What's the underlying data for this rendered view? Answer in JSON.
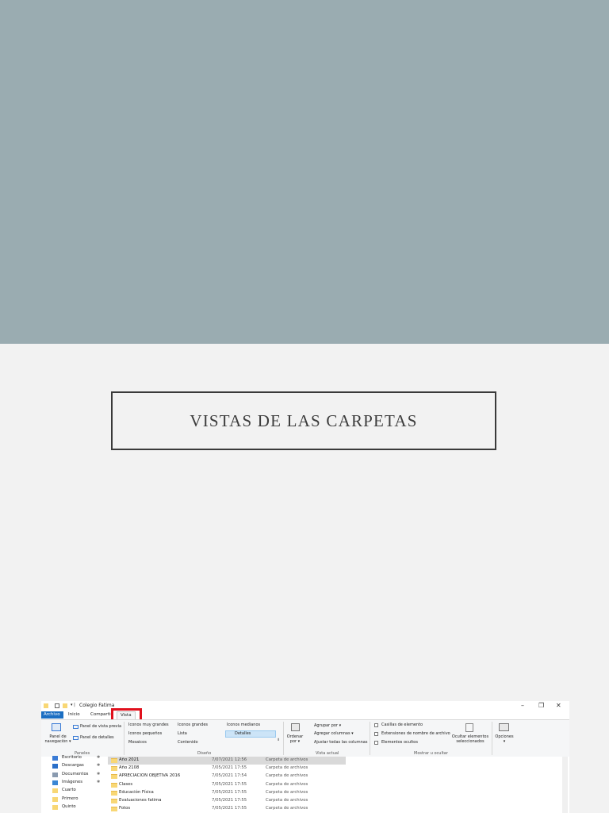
{
  "slide": {
    "title": "VISTAS DE LAS CARPETAS"
  },
  "window": {
    "title": "Colegio Fatima",
    "qa_separator": "▾ |"
  },
  "tabs": [
    "Archivo",
    "Inicio",
    "Compartir",
    "Vista"
  ],
  "ribbon": {
    "panel_navegacion": "Panel de navegación ▾",
    "panel_vista_previa": "Panel de vista previa",
    "panel_detalles": "Panel de detalles",
    "group_paneles": "Paneles",
    "layout": {
      "iconos_muy_grandes": "Iconos muy grandes",
      "iconos_grandes": "Iconos grandes",
      "iconos_medianos": "Iconos medianos",
      "iconos_pequenos": "Iconos pequeños",
      "lista": "Lista",
      "detalles": "Detalles",
      "mosaicos": "Mosaicos",
      "contenido": "Contenido"
    },
    "group_diseno": "Diseño",
    "ordenar_por": "Ordenar por ▾",
    "agrupar_por": "Agrupar por ▾",
    "agregar_columnas": "Agregar columnas ▾",
    "ajustar_columnas": "Ajustar todas las columnas",
    "group_vista_actual": "Vista actual",
    "casillas": "Casillas de elemento",
    "extensiones": "Extensiones de nombre de archivo",
    "ocultos": "Elementos ocultos",
    "ocultar_elementos": "Ocultar elementos seleccionados",
    "group_mostrar": "Mostrar u ocultar",
    "opciones": "Opciones ▾"
  },
  "nav": [
    {
      "label": "Escritorio",
      "pin": "✱",
      "color": "#3a7bd5"
    },
    {
      "label": "Descargas",
      "pin": "✱",
      "color": "#2a6fc9"
    },
    {
      "label": "Documentos",
      "pin": "✱",
      "color": "#8a9bb0"
    },
    {
      "label": "Imágenes",
      "pin": "✱",
      "color": "#3a86d4"
    },
    {
      "label": "Cuarto",
      "pin": "",
      "color": "#f8d775"
    },
    {
      "label": "Primero",
      "pin": "",
      "color": "#f8d775"
    },
    {
      "label": "Quinto",
      "pin": "",
      "color": "#f8d775"
    }
  ],
  "files": [
    {
      "name": "Año 2021",
      "date": "7/07/2021 12:56",
      "type": "Carpeta de archivos",
      "selected": true
    },
    {
      "name": "Año 2108",
      "date": "7/05/2021 17:55",
      "type": "Carpeta de archivos"
    },
    {
      "name": "APRECIACION OBJETIVA 2016",
      "date": "7/05/2021 17:54",
      "type": "Carpeta de archivos"
    },
    {
      "name": "Clases",
      "date": "7/05/2021 17:55",
      "type": "Carpeta de archivos"
    },
    {
      "name": "Educación Física",
      "date": "7/05/2021 17:55",
      "type": "Carpeta de archivos"
    },
    {
      "name": "Evaluaciones fatima",
      "date": "7/05/2021 17:55",
      "type": "Carpeta de archivos"
    },
    {
      "name": "Fotos",
      "date": "7/05/2021 17:55",
      "type": "Carpeta de archivos"
    }
  ],
  "colors": {
    "accent": "#1b6ec2",
    "highlight": "#e0101c",
    "band": "#9aacb1"
  }
}
